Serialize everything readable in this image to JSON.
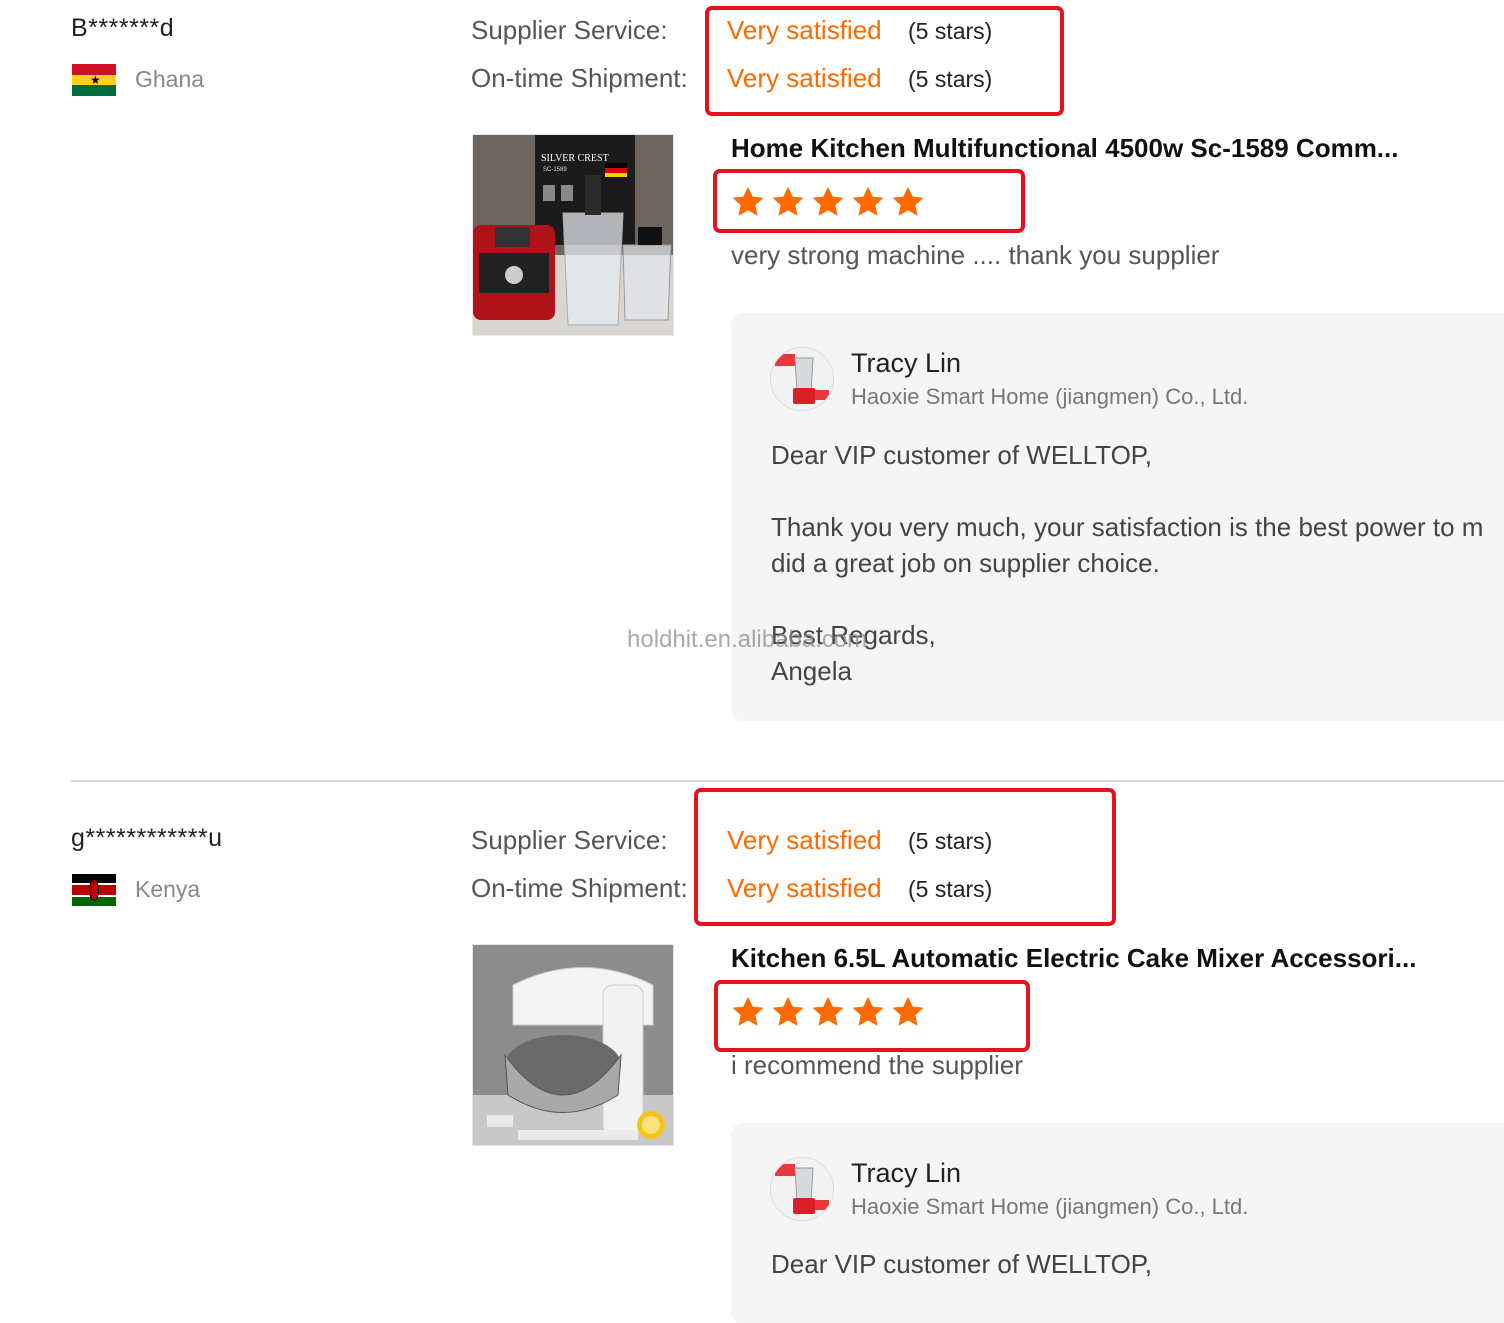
{
  "reviews": [
    {
      "buyer": "B*******d",
      "country": "Ghana",
      "supplier_service_label": "Supplier Service:",
      "supplier_service_value": "Very satisfied",
      "supplier_service_stars": "(5 stars)",
      "shipment_label": "On-time Shipment:",
      "shipment_value": "Very satisfied",
      "shipment_stars": "(5 stars)",
      "product_title": "Home Kitchen Multifunctional 4500w Sc-1589 Comm...",
      "rating": 5,
      "comment": "very strong machine .... thank you supplier",
      "reply": {
        "name": "Tracy Lin",
        "company": "Haoxie Smart Home (jiangmen) Co., Ltd.",
        "line1": "Dear VIP customer of WELLTOP,",
        "line2": "Thank you very much, your satisfaction is the best power to m",
        "line3": "did a great job on supplier choice.",
        "line4": "Best Regards,",
        "line5": "Angela"
      }
    },
    {
      "buyer": "g************u",
      "country": "Kenya",
      "supplier_service_label": "Supplier Service:",
      "supplier_service_value": "Very satisfied",
      "supplier_service_stars": "(5 stars)",
      "shipment_label": "On-time Shipment:",
      "shipment_value": "Very satisfied",
      "shipment_stars": "(5 stars)",
      "product_title": "Kitchen 6.5L Automatic Electric Cake Mixer Accessori...",
      "rating": 5,
      "comment": "i recommend the supplier",
      "reply": {
        "name": "Tracy Lin",
        "company": "Haoxie Smart Home (jiangmen) Co., Ltd.",
        "line1": "Dear VIP customer of WELLTOP,"
      }
    }
  ],
  "watermark": "holdhit.en.alibaba.com",
  "colors": {
    "accent": "#ff6a00",
    "highlight_box": "#e5111b"
  },
  "product_image_text": {
    "brand": "SILVER CREST",
    "model": "SC-1589"
  },
  "icons": [
    "ghana-flag-icon",
    "kenya-flag-icon",
    "star-icon",
    "supplier-avatar"
  ]
}
